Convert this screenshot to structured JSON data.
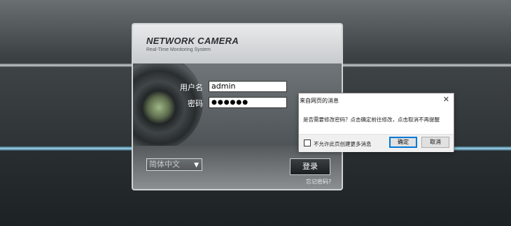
{
  "brand": {
    "title": "NETWORK CAMERA",
    "subtitle": "Real-Time Monitoring System"
  },
  "login": {
    "username_label": "用户名",
    "username_value": "admin",
    "password_label": "密码",
    "password_value": "●●●●●●",
    "language_value": "简体中文",
    "login_button": "登录",
    "forgot_link": "忘记密码?"
  },
  "dialog": {
    "title": "来自网页的消息",
    "close_glyph": "✕",
    "message": "是否需要修改密码？点击确定前往修改，点击取消不再提醒",
    "checkbox_label": "不允许此页创建更多消息",
    "ok_label": "确定",
    "cancel_label": "取消"
  },
  "colors": {
    "accent_band": "#9fd4ec",
    "dialog_focus": "#0078d7"
  }
}
